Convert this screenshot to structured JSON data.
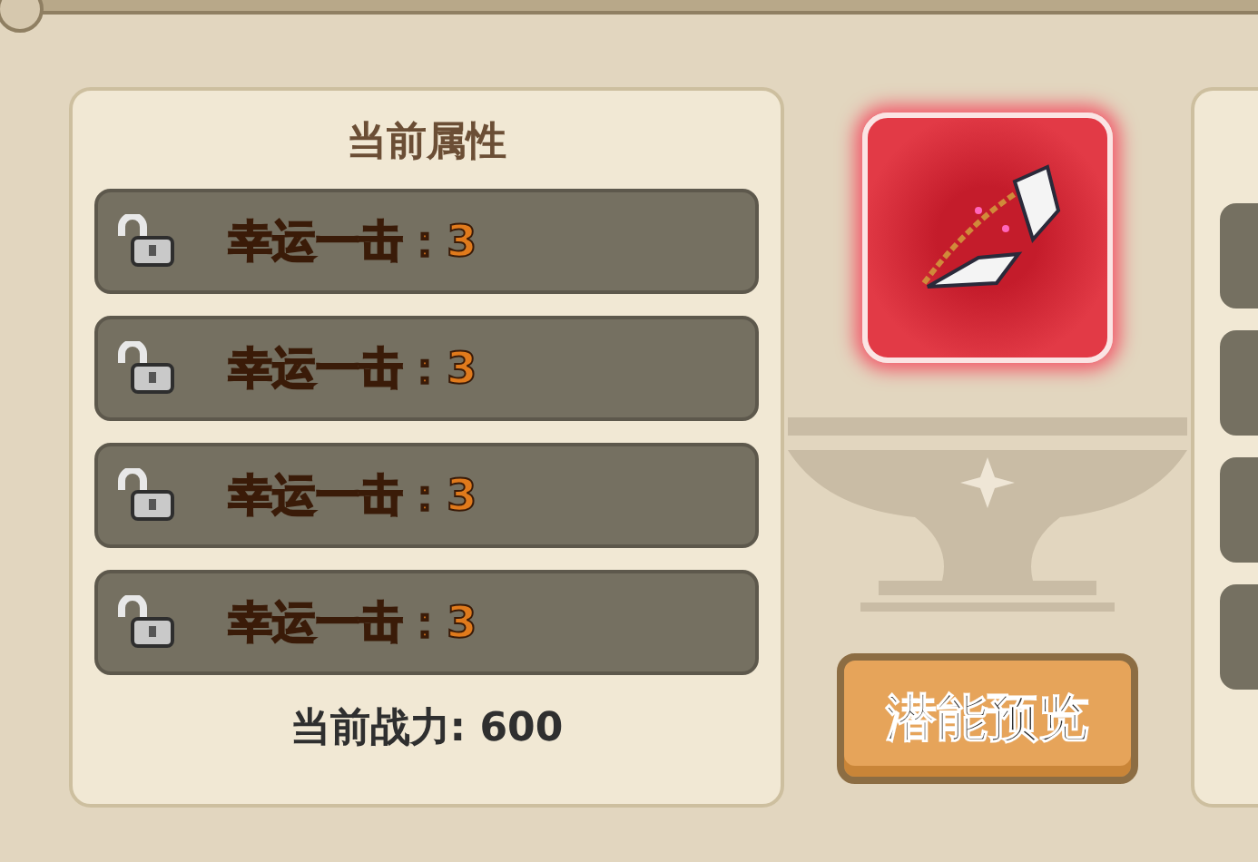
{
  "current_panel": {
    "title": "当前属性",
    "attributes": [
      {
        "text": "幸运一击：3",
        "locked": false
      },
      {
        "text": "幸运一击：3",
        "locked": false
      },
      {
        "text": "幸运一击：3",
        "locked": false
      },
      {
        "text": "幸运一击：3",
        "locked": false
      }
    ],
    "power": "当前战力: 600"
  },
  "preview_button": "潜能预览"
}
